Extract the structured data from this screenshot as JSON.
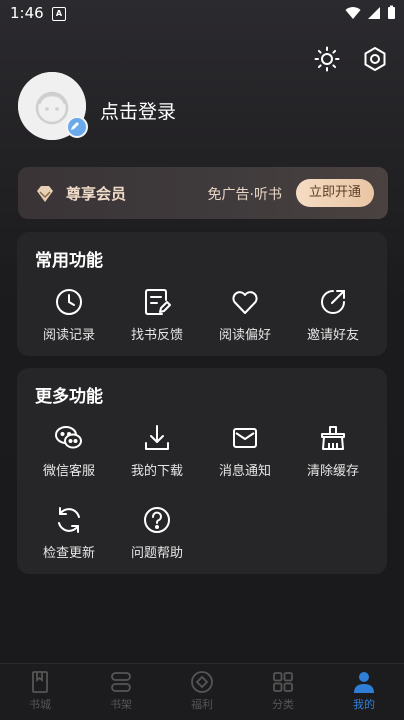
{
  "status_bar": {
    "time": "1:46",
    "notif_letter": "A"
  },
  "profile": {
    "login_text": "点击登录"
  },
  "vip": {
    "title": "尊享会员",
    "desc": "免广告·听书",
    "button": "立即开通"
  },
  "common": {
    "title": "常用功能",
    "items": [
      {
        "label": "阅读记录",
        "icon": "clock-icon"
      },
      {
        "label": "找书反馈",
        "icon": "feedback-icon"
      },
      {
        "label": "阅读偏好",
        "icon": "heart-icon"
      },
      {
        "label": "邀请好友",
        "icon": "share-icon"
      }
    ]
  },
  "more": {
    "title": "更多功能",
    "items": [
      {
        "label": "微信客服",
        "icon": "wechat-icon"
      },
      {
        "label": "我的下载",
        "icon": "download-icon"
      },
      {
        "label": "消息通知",
        "icon": "mail-icon"
      },
      {
        "label": "清除缓存",
        "icon": "clean-icon"
      },
      {
        "label": "检查更新",
        "icon": "refresh-icon"
      },
      {
        "label": "问题帮助",
        "icon": "help-icon"
      }
    ]
  },
  "tabs": [
    {
      "label": "书城",
      "icon": "book-icon"
    },
    {
      "label": "书架",
      "icon": "shelf-icon"
    },
    {
      "label": "福利",
      "icon": "gift-icon"
    },
    {
      "label": "分类",
      "icon": "category-icon"
    },
    {
      "label": "我的",
      "icon": "user-icon",
      "active": true
    }
  ],
  "colors": {
    "accent": "#2f7fd8",
    "vip_button": "#f0d2b4",
    "card": "#262628"
  }
}
